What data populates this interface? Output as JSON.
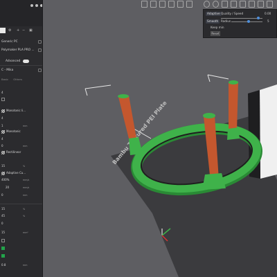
{
  "sidebar": {
    "printer": "Generic PC",
    "filament": "Polymaker PLA PRO ...",
    "advanced_label": "Advanced",
    "profile": "C - Mika",
    "tabs": [
      "Basic",
      "Others"
    ],
    "fields": [
      {
        "value": "4"
      },
      {
        "value": ""
      },
      {
        "value": "Monotonic li..."
      },
      {
        "value": "4"
      },
      {
        "value": "1",
        "unit": "mm"
      },
      {
        "value": "Monotonic"
      },
      {
        "value": "4"
      },
      {
        "value": "0",
        "unit": "mm"
      },
      {
        "value": "Rectilinear"
      },
      {
        "value": "15",
        "unit": "%"
      },
      {
        "value": "Adaptive Cu..."
      },
      {
        "value": "400%",
        "unit": "mm/s"
      },
      {
        "value": "20",
        "unit": "mm/s"
      },
      {
        "value": "0",
        "unit": "mm"
      },
      {
        "value": "15",
        "unit": "%"
      },
      {
        "value": "45",
        "unit": "%"
      },
      {
        "value": "0",
        "unit": ""
      },
      {
        "value": "15",
        "unit": "mm²"
      },
      {
        "value": "0.8",
        "unit": "mm"
      }
    ]
  },
  "toolbar": {
    "icons": [
      "add-icon",
      "delete-icon",
      "arrange-icon",
      "orient-icon",
      "plate-icon",
      "split-icon",
      "move-icon",
      "rotate-icon",
      "scale-icon",
      "cut-icon",
      "support-icon",
      "seam-icon"
    ]
  },
  "adaptive_panel": {
    "adaptive_button": "Adaptive",
    "quality_speed_label": "Quality / Speed",
    "quality_speed_value": "0.00",
    "quality_speed_fraction": 0.9,
    "smooth_button": "Smooth",
    "radius_label": "Radius",
    "radius_value": "5",
    "radius_fraction": 0.55,
    "keep_min_label": "Keep min",
    "reset_label": "Reset"
  },
  "viewport": {
    "bed_label": "Bambu Textured PEI Plate",
    "colors": {
      "tower": "#c4572e",
      "ring": "#3fb24a",
      "bed": "#3b3b3e",
      "background": "#5e5e62"
    }
  }
}
